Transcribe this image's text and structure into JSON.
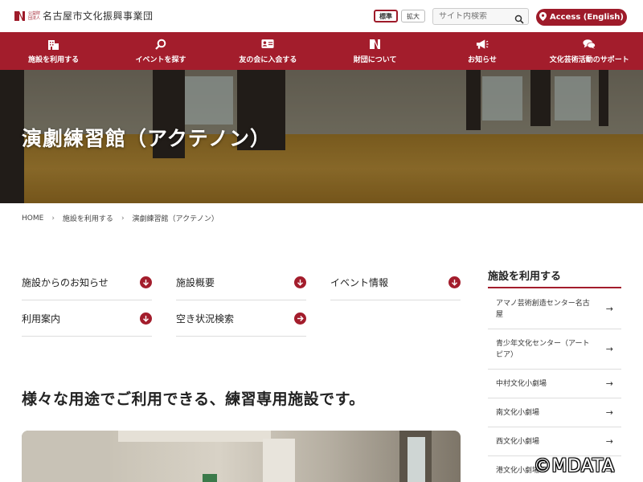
{
  "header": {
    "logo_small": "公益財団法人",
    "logo_text": "名古屋市文化振興事業団",
    "size_standard": "標準",
    "size_large": "拡大",
    "search_placeholder": "サイト内検索",
    "access_label": "Access (English)"
  },
  "nav": {
    "items": [
      {
        "label": "施設を利用する",
        "icon": "building-icon"
      },
      {
        "label": "イベントを探す",
        "icon": "search-icon"
      },
      {
        "label": "友の会に入会する",
        "icon": "member-card-icon"
      },
      {
        "label": "財団について",
        "icon": "foundation-logo-icon"
      },
      {
        "label": "お知らせ",
        "icon": "megaphone-icon"
      },
      {
        "label": "文化芸術活動のサポート",
        "icon": "chat-bubbles-icon"
      }
    ]
  },
  "hero": {
    "title": "演劇練習館（アクテノン）"
  },
  "breadcrumb": {
    "items": [
      "HOME",
      "施設を利用する",
      "演劇練習館（アクテノン）"
    ]
  },
  "links": {
    "items": [
      {
        "label": "施設からのお知らせ",
        "icon": "arrow-down-circle-icon"
      },
      {
        "label": "施設概要",
        "icon": "arrow-down-circle-icon"
      },
      {
        "label": "イベント情報",
        "icon": "arrow-down-circle-icon"
      },
      {
        "label": "利用案内",
        "icon": "arrow-down-circle-icon"
      },
      {
        "label": "空き状況検索",
        "icon": "arrow-right-circle-icon"
      }
    ]
  },
  "main": {
    "heading": "様々な用途でご利用できる、練習専用施設です。"
  },
  "sidebar": {
    "title": "施設を利用する",
    "items": [
      {
        "label": "アマノ芸術創造センター名古屋"
      },
      {
        "label": "青少年文化センター（アートピア）"
      },
      {
        "label": "中村文化小劇場"
      },
      {
        "label": "南文化小劇場"
      },
      {
        "label": "西文化小劇場"
      },
      {
        "label": "港文化小劇場"
      }
    ]
  },
  "watermark": "©MDATA",
  "colors": {
    "brand": "#a31d2c"
  }
}
